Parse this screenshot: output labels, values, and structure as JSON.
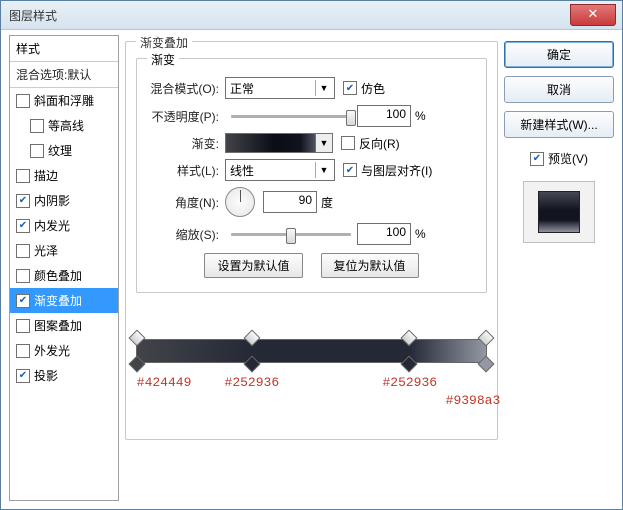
{
  "window": {
    "title": "图层样式"
  },
  "styles_list": {
    "header": "样式",
    "blend_defaults": "混合选项:默认",
    "items": [
      {
        "label": "斜面和浮雕",
        "checked": false,
        "indent": false
      },
      {
        "label": "等高线",
        "checked": false,
        "indent": true
      },
      {
        "label": "纹理",
        "checked": false,
        "indent": true
      },
      {
        "label": "描边",
        "checked": false,
        "indent": false
      },
      {
        "label": "内阴影",
        "checked": true,
        "indent": false
      },
      {
        "label": "内发光",
        "checked": true,
        "indent": false
      },
      {
        "label": "光泽",
        "checked": false,
        "indent": false
      },
      {
        "label": "颜色叠加",
        "checked": false,
        "indent": false
      },
      {
        "label": "渐变叠加",
        "checked": true,
        "indent": false,
        "selected": true
      },
      {
        "label": "图案叠加",
        "checked": false,
        "indent": false
      },
      {
        "label": "外发光",
        "checked": false,
        "indent": false
      },
      {
        "label": "投影",
        "checked": true,
        "indent": false
      }
    ]
  },
  "panel": {
    "group_title": "渐变叠加",
    "gradient_title": "渐变",
    "blend_mode_label": "混合模式(O):",
    "blend_mode_value": "正常",
    "dither_label": "仿色",
    "dither_checked": true,
    "opacity_label": "不透明度(P):",
    "opacity_value": "100",
    "opacity_pct": 100,
    "gradient_label": "渐变:",
    "reverse_label": "反向(R)",
    "reverse_checked": false,
    "style_label": "样式(L):",
    "style_value": "线性",
    "align_label": "与图层对齐(I)",
    "align_checked": true,
    "angle_label": "角度(N):",
    "angle_value": "90",
    "angle_unit": "度",
    "scale_label": "缩放(S):",
    "scale_value": "100",
    "scale_pct": 50,
    "percent": "%",
    "btn_set_default": "设置为默认值",
    "btn_reset_default": "复位为默认值"
  },
  "gradient_stops": [
    {
      "pos": 0,
      "color": "#424449"
    },
    {
      "pos": 33,
      "color": "#252936"
    },
    {
      "pos": 78,
      "color": "#252936"
    },
    {
      "pos": 100,
      "color": "#9398a3"
    }
  ],
  "right": {
    "ok": "确定",
    "cancel": "取消",
    "new_style": "新建样式(W)...",
    "preview_label": "预览(V)",
    "preview_checked": true
  }
}
